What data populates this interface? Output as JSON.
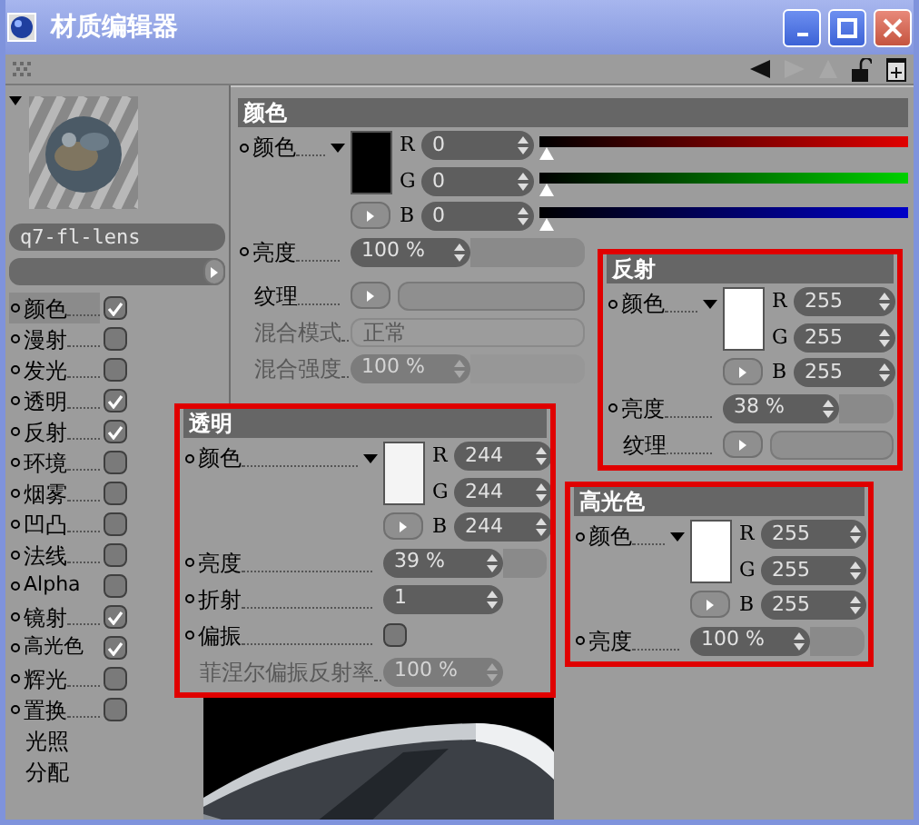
{
  "window": {
    "title": "材质编辑器"
  },
  "material": {
    "name": "q7-fl-lens"
  },
  "channels": [
    {
      "label": "颜色",
      "kind": "channel",
      "selected": true,
      "checked": true
    },
    {
      "label": "漫射",
      "kind": "channel",
      "selected": false,
      "checked": false
    },
    {
      "label": "发光",
      "kind": "channel",
      "selected": false,
      "checked": false
    },
    {
      "label": "透明",
      "kind": "channel",
      "selected": false,
      "checked": true
    },
    {
      "label": "反射",
      "kind": "channel",
      "selected": false,
      "checked": true
    },
    {
      "label": "环境",
      "kind": "channel",
      "selected": false,
      "checked": false
    },
    {
      "label": "烟雾",
      "kind": "channel",
      "selected": false,
      "checked": false
    },
    {
      "label": "凹凸",
      "kind": "channel",
      "selected": false,
      "checked": false
    },
    {
      "label": "法线",
      "kind": "channel",
      "selected": false,
      "checked": false
    },
    {
      "label": "Alpha",
      "kind": "channel",
      "selected": false,
      "checked": false
    },
    {
      "label": "镜射",
      "kind": "channel",
      "selected": false,
      "checked": true
    },
    {
      "label": "高光色",
      "kind": "channel",
      "selected": false,
      "checked": true
    },
    {
      "label": "辉光",
      "kind": "channel",
      "selected": false,
      "checked": false
    },
    {
      "label": "置换",
      "kind": "channel",
      "selected": false,
      "checked": false
    },
    {
      "label": "光照",
      "kind": "plain",
      "selected": false
    },
    {
      "label": "分配",
      "kind": "plain",
      "selected": false
    }
  ],
  "color_section": {
    "title": "颜色",
    "rows": [
      {
        "kind": "color",
        "label": "颜色",
        "animated": true,
        "rgb": [
          {
            "letter": "R",
            "value": "0",
            "level": 0
          },
          {
            "letter": "G",
            "value": "0",
            "level": 0
          },
          {
            "letter": "B",
            "value": "0",
            "level": 0
          }
        ]
      },
      {
        "kind": "number",
        "label": "亮度",
        "animated": true,
        "value": "100 %",
        "track": true
      },
      {
        "kind": "texture",
        "label": "纹理"
      },
      {
        "kind": "select",
        "label": "混合模式",
        "value": "正常",
        "disabled": true
      },
      {
        "kind": "number",
        "label": "混合强度",
        "value": "100 %",
        "disabled": true,
        "track": true
      }
    ]
  },
  "callouts": [
    {
      "title": "反射",
      "rows": [
        {
          "kind": "color",
          "label": "颜色",
          "animated": true,
          "rgb": [
            {
              "letter": "R",
              "value": "255"
            },
            {
              "letter": "G",
              "value": "255"
            },
            {
              "letter": "B",
              "value": "255"
            }
          ]
        },
        {
          "kind": "number",
          "label": "亮度",
          "animated": true,
          "value": "38 %",
          "track": true
        },
        {
          "kind": "texture",
          "label": "纹理"
        }
      ]
    },
    {
      "title": "透明",
      "rows": [
        {
          "kind": "color",
          "label": "颜色",
          "animated": true,
          "rgb": [
            {
              "letter": "R",
              "value": "244"
            },
            {
              "letter": "G",
              "value": "244"
            },
            {
              "letter": "B",
              "value": "244"
            }
          ]
        },
        {
          "kind": "number",
          "label": "亮度",
          "animated": true,
          "value": "39 %",
          "track": true
        },
        {
          "kind": "number",
          "label": "折射",
          "animated": true,
          "value": "1",
          "track": false
        },
        {
          "kind": "checkbox",
          "label": "偏振",
          "animated": true,
          "checked": false
        },
        {
          "kind": "number",
          "label": "菲涅尔偏振反射率",
          "value": "100 %",
          "disabled": true,
          "track": false
        }
      ]
    },
    {
      "title": "高光色",
      "rows": [
        {
          "kind": "color",
          "label": "颜色",
          "animated": true,
          "rgb": [
            {
              "letter": "R",
              "value": "255"
            },
            {
              "letter": "G",
              "value": "255"
            },
            {
              "letter": "B",
              "value": "255"
            }
          ]
        },
        {
          "kind": "number",
          "label": "亮度",
          "animated": true,
          "value": "100 %",
          "track": true
        }
      ]
    }
  ]
}
